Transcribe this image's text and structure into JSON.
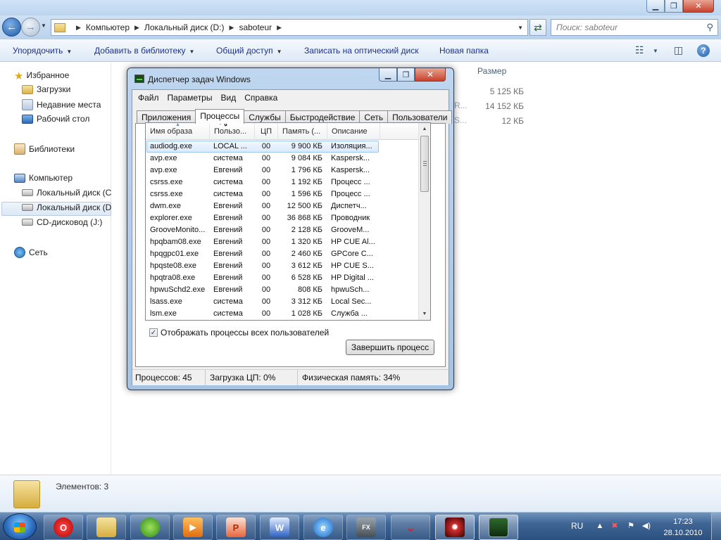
{
  "explorer": {
    "address": {
      "crumbs": [
        "Компьютер",
        "Локальный диск (D:)",
        "saboteur"
      ]
    },
    "search_placeholder": "Поиск: saboteur",
    "toolbar": {
      "organize": "Упорядочить",
      "add_to_library": "Добавить в библиотеку",
      "share": "Общий доступ",
      "burn": "Записать на оптический диск",
      "new_folder": "Новая папка"
    },
    "nav": {
      "favorites": "Избранное",
      "downloads": "Загрузки",
      "recent": "Недавние места",
      "desktop": "Рабочий стол",
      "libraries": "Библиотеки",
      "computer": "Компьютер",
      "drive_c": "Локальный диск (C",
      "drive_d": "Локальный диск (D",
      "cd_drive": "CD-дисковод (J:)",
      "network": "Сеть"
    },
    "columns": {
      "size": "Размер"
    },
    "files": [
      {
        "size": "5 125 КБ",
        "fragment": ""
      },
      {
        "size": "14 152 КБ",
        "fragment": "R..."
      },
      {
        "size": "12 КБ",
        "fragment": "S..."
      }
    ],
    "details": {
      "count": "Элементов: 3"
    }
  },
  "taskmgr": {
    "title": "Диспетчер задач Windows",
    "menu": [
      "Файл",
      "Параметры",
      "Вид",
      "Справка"
    ],
    "tabs": [
      "Приложения",
      "Процессы",
      "Службы",
      "Быстродействие",
      "Сеть",
      "Пользователи"
    ],
    "active_tab": "Процессы",
    "columns": [
      "Имя образа",
      "Пользо...",
      "ЦП",
      "Память (...",
      "Описание"
    ],
    "processes": [
      [
        "audiodg.exe",
        "LOCAL ...",
        "00",
        "9 900 КБ",
        "Изоляция..."
      ],
      [
        "avp.exe",
        "система",
        "00",
        "9 084 КБ",
        "Kaspersk..."
      ],
      [
        "avp.exe",
        "Евгений",
        "00",
        "1 796 КБ",
        "Kaspersk..."
      ],
      [
        "csrss.exe",
        "система",
        "00",
        "1 192 КБ",
        "Процесс ..."
      ],
      [
        "csrss.exe",
        "система",
        "00",
        "1 596 КБ",
        "Процесс ..."
      ],
      [
        "dwm.exe",
        "Евгений",
        "00",
        "12 500 КБ",
        "Диспетч..."
      ],
      [
        "explorer.exe",
        "Евгений",
        "00",
        "36 868 КБ",
        "Проводник"
      ],
      [
        "GrooveMonito...",
        "Евгений",
        "00",
        "2 128 КБ",
        "GrooveM..."
      ],
      [
        "hpqbam08.exe",
        "Евгений",
        "00",
        "1 320 КБ",
        "HP CUE Al..."
      ],
      [
        "hpqgpc01.exe",
        "Евгений",
        "00",
        "2 460 КБ",
        "GPCore C..."
      ],
      [
        "hpqste08.exe",
        "Евгений",
        "00",
        "3 612 КБ",
        "HP CUE S..."
      ],
      [
        "hpqtra08.exe",
        "Евгений",
        "00",
        "6 528 КБ",
        "HP Digital ..."
      ],
      [
        "hpwuSchd2.exe",
        "Евгений",
        "00",
        "808 КБ",
        "hpwuSch..."
      ],
      [
        "lsass.exe",
        "система",
        "00",
        "3 312 КБ",
        "Local Sec..."
      ],
      [
        "lsm.exe",
        "система",
        "00",
        "1 028 КБ",
        "Служба ..."
      ]
    ],
    "show_all_label": "Отображать процессы всех пользователей",
    "show_all_checked": true,
    "end_process": "Завершить процесс",
    "status": {
      "processes": "Процессов: 45",
      "cpu": "Загрузка ЦП: 0%",
      "memory": "Физическая память: 34%"
    }
  },
  "taskbar": {
    "lang": "RU",
    "time": "17:23",
    "date": "28.10.2010",
    "apps": [
      "opera-icon",
      "explorer-icon",
      "media-center-icon",
      "media-player-icon",
      "powerpoint-icon",
      "word-icon",
      "internet-explorer-icon",
      "gis-fx-icon",
      "network-swoosh-icon",
      "game-icon",
      "task-manager-icon"
    ]
  },
  "colors": {
    "accent": "#1f5aa6",
    "selection": "#dbeafc",
    "taskbar": "#3f6595",
    "close_red": "#c7422c"
  }
}
